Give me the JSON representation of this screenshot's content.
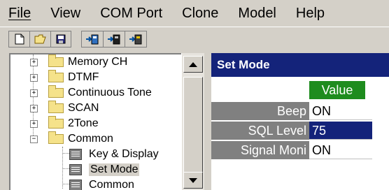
{
  "menu": {
    "file": "File",
    "view": "View",
    "com_port": "COM Port",
    "clone": "Clone",
    "model": "Model",
    "help": "Help"
  },
  "toolbar": {
    "icons": [
      "new-file-icon",
      "open-folder-icon",
      "save-icon",
      "radio-write-icon",
      "radio-read-icon",
      "radio-clone-icon"
    ]
  },
  "tree": {
    "items": [
      {
        "label": "Memory CH",
        "type": "folder",
        "expander": "+"
      },
      {
        "label": "DTMF",
        "type": "folder",
        "expander": "+"
      },
      {
        "label": "Continuous Tone",
        "type": "folder",
        "expander": "+"
      },
      {
        "label": "SCAN",
        "type": "folder",
        "expander": "+"
      },
      {
        "label": "2Tone",
        "type": "folder",
        "expander": "+"
      },
      {
        "label": "Common",
        "type": "folder",
        "expander": "−"
      },
      {
        "label": "Key & Display",
        "type": "doc"
      },
      {
        "label": "Set Mode",
        "type": "doc",
        "selected": true
      },
      {
        "label": "Common",
        "type": "doc"
      }
    ]
  },
  "panel": {
    "title": "Set Mode",
    "value_header": "Value",
    "rows": [
      {
        "label": "Beep",
        "value": "ON"
      },
      {
        "label": "SQL Level",
        "value": "75",
        "selected": true
      },
      {
        "label": "Signal Moni",
        "value": "ON"
      }
    ]
  },
  "colors": {
    "title_bar": "#14237a",
    "value_header": "#1e8c1e",
    "row_label_bg": "#808080",
    "selected_value_bg": "#14237a",
    "folder": "#f5e28a"
  }
}
